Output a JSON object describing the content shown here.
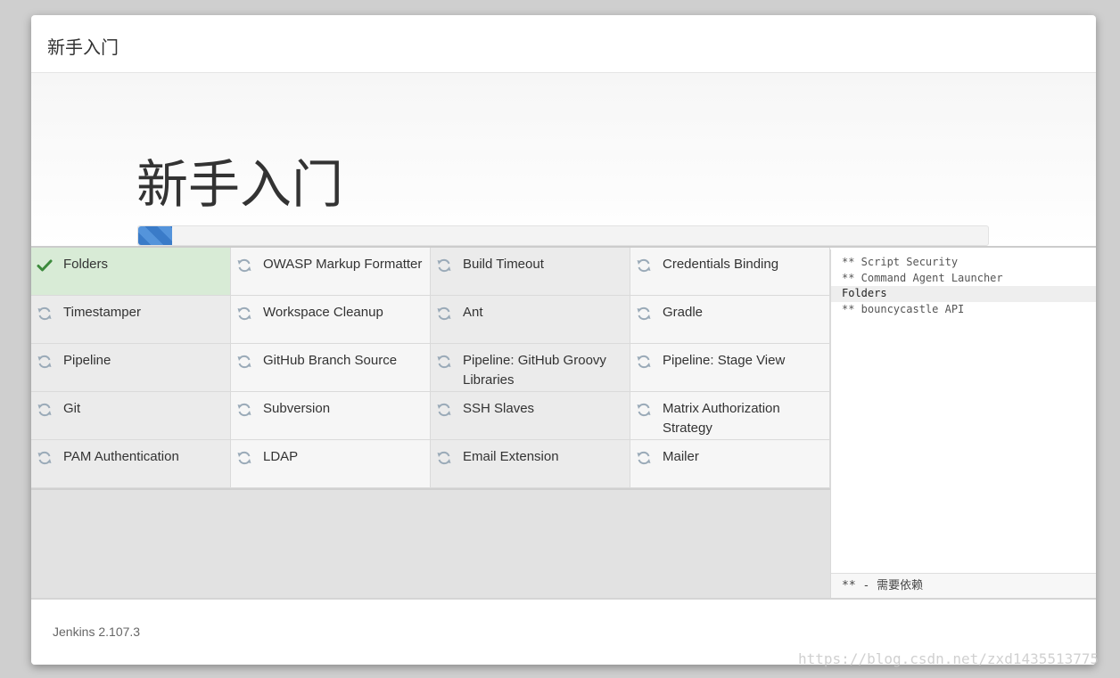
{
  "dialog": {
    "title": "新手入门"
  },
  "hero": {
    "title": "新手入门",
    "progress_percent": 4
  },
  "plugins": [
    {
      "name": "Folders",
      "status": "success"
    },
    {
      "name": "OWASP Markup Formatter",
      "status": "pending"
    },
    {
      "name": "Build Timeout",
      "status": "pending"
    },
    {
      "name": "Credentials Binding",
      "status": "pending"
    },
    {
      "name": "Timestamper",
      "status": "pending"
    },
    {
      "name": "Workspace Cleanup",
      "status": "pending"
    },
    {
      "name": "Ant",
      "status": "pending"
    },
    {
      "name": "Gradle",
      "status": "pending"
    },
    {
      "name": "Pipeline",
      "status": "pending"
    },
    {
      "name": "GitHub Branch Source",
      "status": "pending"
    },
    {
      "name": "Pipeline: GitHub Groovy Libraries",
      "status": "pending"
    },
    {
      "name": "Pipeline: Stage View",
      "status": "pending"
    },
    {
      "name": "Git",
      "status": "pending"
    },
    {
      "name": "Subversion",
      "status": "pending"
    },
    {
      "name": "SSH Slaves",
      "status": "pending"
    },
    {
      "name": "Matrix Authorization Strategy",
      "status": "pending"
    },
    {
      "name": "PAM Authentication",
      "status": "pending"
    },
    {
      "name": "LDAP",
      "status": "pending"
    },
    {
      "name": "Email Extension",
      "status": "pending"
    },
    {
      "name": "Mailer",
      "status": "pending"
    }
  ],
  "icons": {
    "success": "check-icon",
    "pending": "refresh-icon"
  },
  "colors": {
    "success_bg": "#d8ebd6",
    "check": "#3c8a3c",
    "refresh": "#9aaab8",
    "progress": "#3a7bc8"
  },
  "log": {
    "lines": [
      {
        "text": "** Script Security",
        "current": false
      },
      {
        "text": "** Command Agent Launcher",
        "current": false
      },
      {
        "text": "Folders",
        "current": true
      },
      {
        "text": "** bouncycastle API",
        "current": false
      }
    ],
    "footer": "** - 需要依赖"
  },
  "footer": {
    "version": "Jenkins 2.107.3"
  },
  "watermark": "https://blog.csdn.net/zxd1435513775"
}
